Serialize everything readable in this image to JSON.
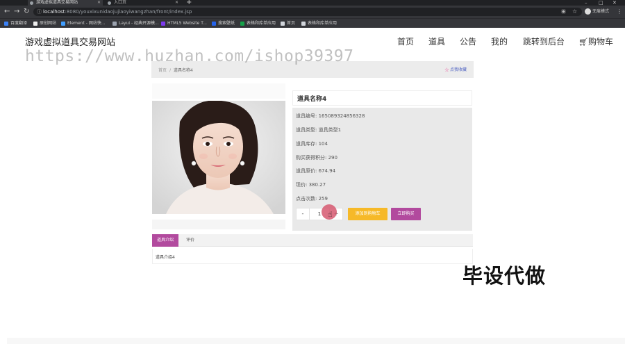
{
  "browser": {
    "tabs": [
      {
        "label": "游戏虚拟道具交易网站",
        "active": true
      },
      {
        "label": "入口页",
        "active": false
      }
    ],
    "new_tab": "+",
    "window_controls": [
      "–",
      "□",
      "✕"
    ],
    "url_host": "localhost",
    "url_path": ":8080/youxixunidaojujiaoyiwangzhan/front/index.jsp",
    "profile_label": "无痕模式",
    "bookmarks": [
      "百度翻译",
      "原创网站",
      "Element - 网站快...",
      "Layui - 经典开源模...",
      "HTML5 Website T...",
      "搜索壁纸",
      "表格和库单应用",
      "首页",
      "表格和库单应用"
    ]
  },
  "site": {
    "logo": "游戏虚拟道具交易网站",
    "nav": [
      "首页",
      "道具",
      "公告",
      "我的",
      "跳转到后台",
      "购物车"
    ],
    "cart_icon": "cart-icon",
    "watermark": "https://www.huzhan.com/ishop39397"
  },
  "breadcrumb": {
    "home": "首页",
    "separator": "/",
    "current": "道具名称4",
    "favorite": "点我收藏"
  },
  "product": {
    "title": "道具名称4",
    "fields": [
      {
        "label": "道具编号:",
        "value": "165089324856328"
      },
      {
        "label": "道具类型:",
        "value": "道具类型1"
      },
      {
        "label": "道具库存:",
        "value": "104"
      },
      {
        "label": "购买获得积分:",
        "value": "290"
      },
      {
        "label": "道具原价:",
        "value": "674.94"
      },
      {
        "label": "现价:",
        "value": "380.27"
      },
      {
        "label": "点击次数:",
        "value": "259"
      }
    ],
    "qty_minus": "-",
    "qty_value": "1",
    "qty_plus": "+",
    "add_to_cart": "添加到购物车",
    "buy_now": "立即购买"
  },
  "detail_tabs": {
    "tabs": [
      {
        "label": "道具介绍",
        "active": true
      },
      {
        "label": "评价",
        "active": false
      }
    ],
    "panel_text": "道具介绍4"
  },
  "overlay": {
    "promo": "毕设代做"
  },
  "colors": {
    "accent_purple": "#b24a9e",
    "cart_yellow": "#f6b928",
    "browser_dark": "#35363a"
  }
}
